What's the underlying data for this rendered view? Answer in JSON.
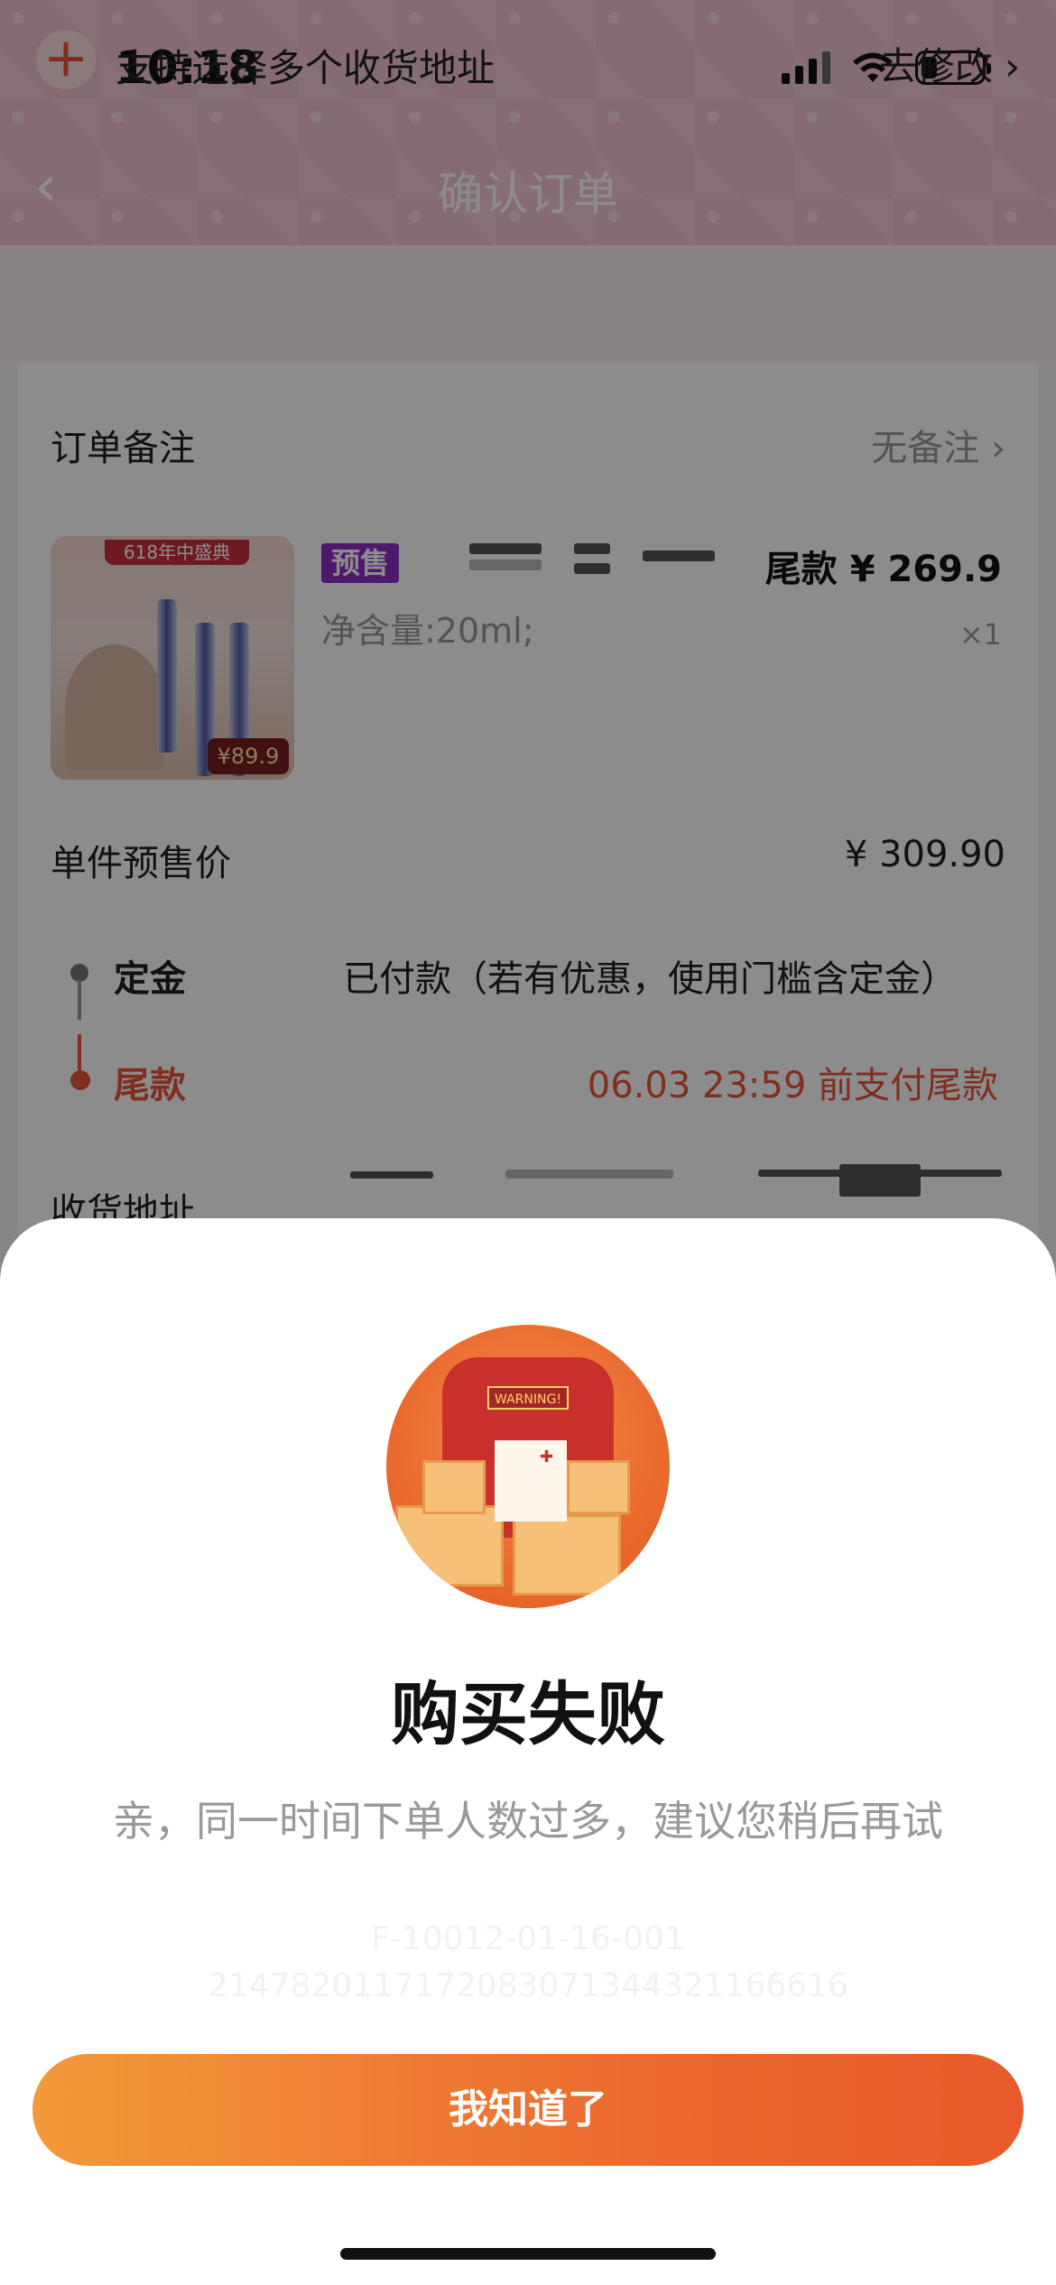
{
  "status_bar": {
    "time": "10:18",
    "battery_level": 0.26
  },
  "header": {
    "title": "确认订单"
  },
  "address_bar": {
    "plus": "+",
    "text": "支持选择多个收货地址",
    "action": "去修改 ›"
  },
  "order_note": {
    "label": "订单备注",
    "value": "无备注 ›"
  },
  "product": {
    "badge": "预售",
    "balance_price": "尾款 ¥ 269.9",
    "spec": "净含量:20ml;",
    "quantity": "×1",
    "image_banner": "618年中盛典",
    "image_price": "¥89.9"
  },
  "unit_price": {
    "label": "单件预售价",
    "value": "¥ 309.90"
  },
  "timeline": {
    "deposit_label": "定金",
    "deposit_status": "已付款（若有优惠，使用门槛含定金）",
    "balance_label": "尾款",
    "balance_deadline": "06.03 23:59 前支付尾款"
  },
  "shipping": {
    "label": "收货地址"
  },
  "dialog": {
    "image_sign": "WARNING!",
    "title": "购买失败",
    "message": "亲，同一时间下单人数过多，建议您稍后再试",
    "code1": "F-10012-01-16-001",
    "code2": "2147820117172083071344321166616",
    "button": "我知道了"
  },
  "colors": {
    "accent": "#e8553a",
    "presale_badge": "#8b2fc9",
    "button_start": "#f39a3a",
    "button_end": "#e85a2a"
  }
}
